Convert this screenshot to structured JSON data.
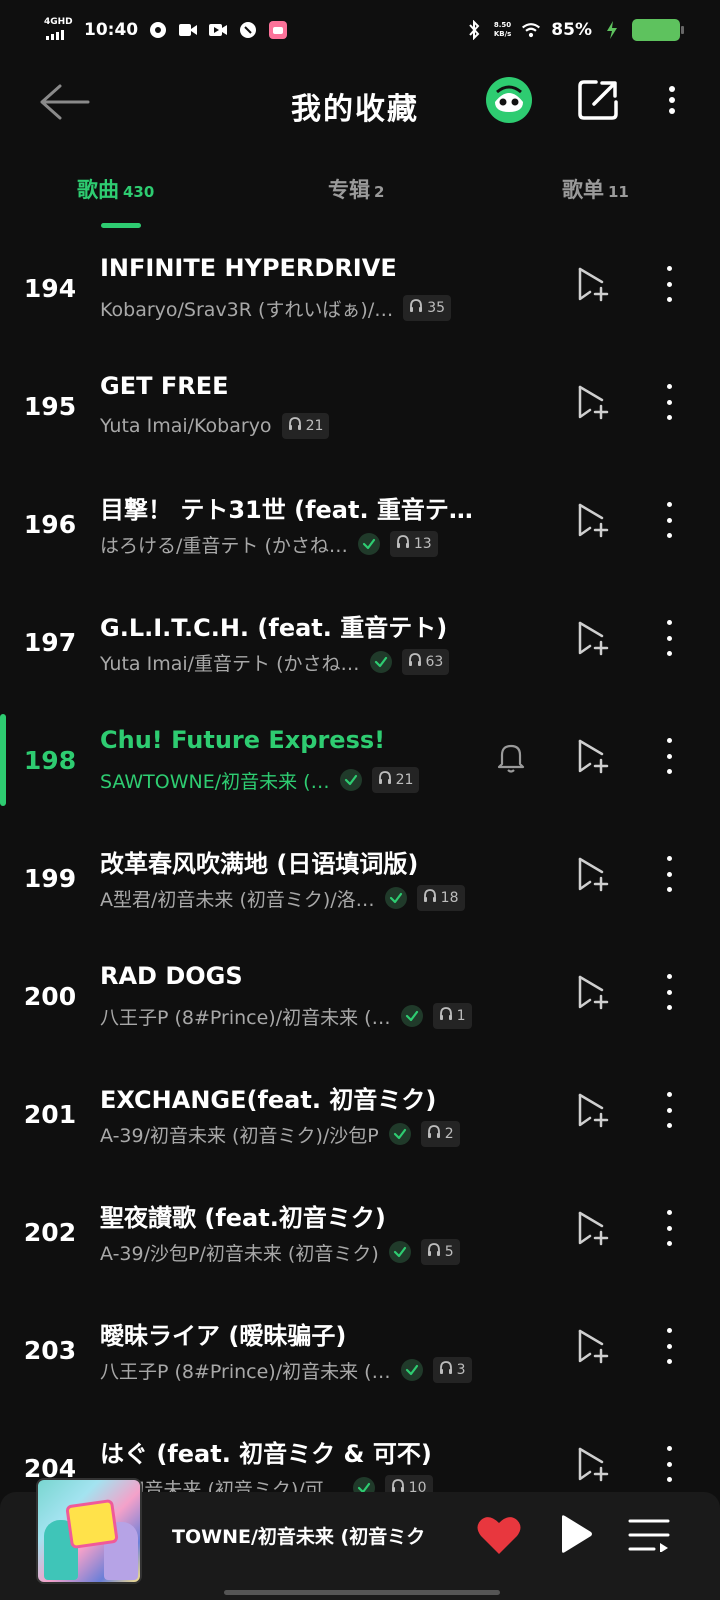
{
  "status_bar": {
    "network": "4GHD",
    "time": "10:40",
    "speed_value": "8.50",
    "speed_unit": "KB/s",
    "battery": "85%"
  },
  "header": {
    "title": "我的收藏"
  },
  "tabs": [
    {
      "label": "歌曲",
      "count": "430"
    },
    {
      "label": "专辑",
      "count": "2"
    },
    {
      "label": "歌单",
      "count": "11"
    }
  ],
  "songs": [
    {
      "num": "194",
      "title": "INFINITE HYPERDRIVE",
      "artist": "Kobaryo/Srav3R (すれいばぁ)/…",
      "downloaded": false,
      "plays": "35"
    },
    {
      "num": "195",
      "title": "GET FREE",
      "artist": "Yuta Imai/Kobaryo",
      "downloaded": false,
      "plays": "21"
    },
    {
      "num": "196",
      "title": "目撃！ テト31世 (feat. 重音テ…",
      "artist": "はろける/重音テト (かさね…",
      "downloaded": true,
      "plays": "13"
    },
    {
      "num": "197",
      "title": "G.L.I.T.C.H. (feat. 重音テト)",
      "artist": "Yuta Imai/重音テト (かさね…",
      "downloaded": true,
      "plays": "63"
    },
    {
      "num": "198",
      "title": "Chu! Future Express!",
      "artist": "SAWTOWNE/初音未来 (…",
      "downloaded": true,
      "plays": "21"
    },
    {
      "num": "199",
      "title": "改革春风吹满地 (日语填词版)",
      "artist": "A型君/初音未来 (初音ミク)/洛…",
      "downloaded": true,
      "plays": "18"
    },
    {
      "num": "200",
      "title": "RAD DOGS",
      "artist": "八王子P (8#Prince)/初音未来 (…",
      "downloaded": true,
      "plays": "1"
    },
    {
      "num": "201",
      "title": "EXCHANGE(feat. 初音ミク)",
      "artist": "A-39/初音未来 (初音ミク)/沙包P",
      "downloaded": true,
      "plays": "2"
    },
    {
      "num": "202",
      "title": "聖夜讃歌 (feat.初音ミク)",
      "artist": "A-39/沙包P/初音未来 (初音ミク)",
      "downloaded": true,
      "plays": "5"
    },
    {
      "num": "203",
      "title": "曖昧ライア (暧昧骗子)",
      "artist": "八王子P (8#Prince)/初音未来 (…",
      "downloaded": true,
      "plays": "3"
    },
    {
      "num": "204",
      "title": "はぐ (feat. 初音ミク & 可不)",
      "artist": "…/初音未来 (初音ミク)/可…",
      "downloaded": true,
      "plays": "10"
    }
  ],
  "player": {
    "now_playing": "TOWNE/初音未来 (初音ミク"
  },
  "colors": {
    "accent": "#2ecc71",
    "background": "#0f0f0f",
    "heart": "#e8373e"
  }
}
